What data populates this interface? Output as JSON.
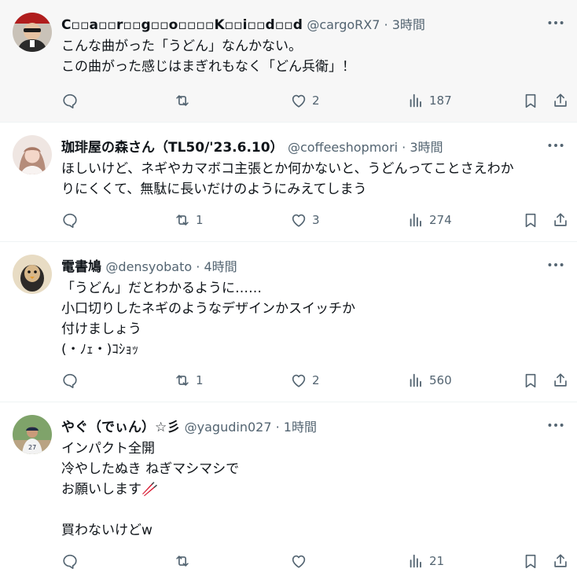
{
  "tweets": [
    {
      "name": "C▫▫a▫▫r▫▫g▫▫o▫▫▫▫K▫▫i▫▫d▫▫d",
      "handle": "@cargoRX7",
      "sep": " · ",
      "time": "3時間",
      "lines": [
        "こんな曲がった「うどん」なんかない。",
        "この曲がった感じはまぎれもなく「どん兵衛」！"
      ],
      "replies": "",
      "retweets": "",
      "likes": "2",
      "views": "187"
    },
    {
      "name": "珈琲屋の森さん（TL50/'23.6.10）",
      "handle": "@coffeeshopmori",
      "sep": " · ",
      "time": "3時間",
      "lines": [
        "ほしいけど、ネギやカマボコ主張とか何かないと、うどんってことさえわか",
        "りにくくて、無駄に長いだけのようにみえてしまう"
      ],
      "replies": "",
      "retweets": "1",
      "likes": "3",
      "views": "274"
    },
    {
      "name": "電書鳩",
      "handle": "@densyobato",
      "sep": " · ",
      "time": "4時間",
      "lines": [
        "「うどん」だとわかるように……",
        "小口切りしたネギのようなデザインかスイッチか",
        "付けましょう",
        "(・ﾉｪ・)ｺｼｮｯ"
      ],
      "replies": "",
      "retweets": "1",
      "likes": "2",
      "views": "560"
    },
    {
      "name": "やぐ（でぃん）☆彡",
      "handle": "@yagudin027",
      "sep": " · ",
      "time": "1時間",
      "lines": [
        "インパクト全開",
        "冷やしたぬき ねぎマシマシで",
        "お願いします🥢",
        "",
        "買わないけどw"
      ],
      "replies": "",
      "retweets": "",
      "likes": "",
      "views": "21"
    }
  ],
  "icons": {
    "more": "more-icon",
    "reply": "reply-icon",
    "retweet": "retweet-icon",
    "like": "heart-icon",
    "views": "views-icon",
    "bookmark": "bookmark-icon",
    "share": "share-icon"
  },
  "colors": {
    "text": "#0f1419",
    "secondary": "#536471",
    "divider": "#eff3f4",
    "hover_bg": "#f7f7f7"
  }
}
